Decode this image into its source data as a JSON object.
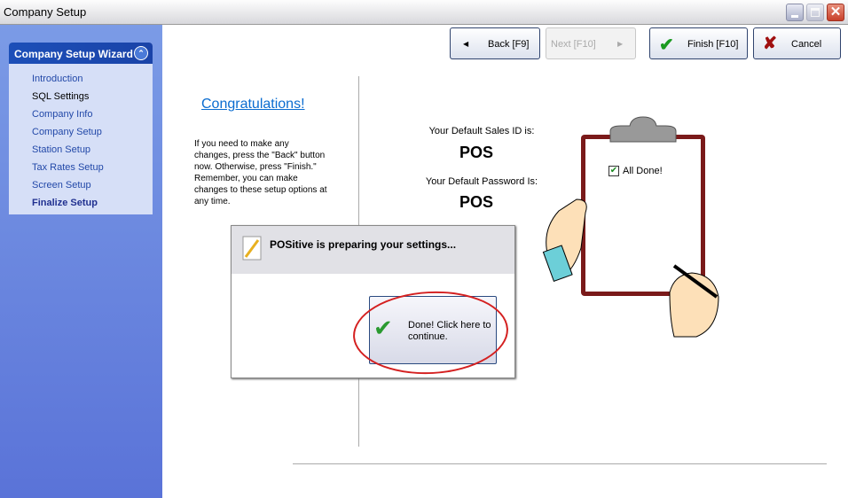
{
  "window": {
    "title": "Company Setup"
  },
  "sidebar": {
    "header": "Company Setup Wizard",
    "items": [
      {
        "label": "Introduction"
      },
      {
        "label": "SQL Settings"
      },
      {
        "label": "Company Info"
      },
      {
        "label": "Company Setup"
      },
      {
        "label": "Station Setup"
      },
      {
        "label": "Tax Rates Setup"
      },
      {
        "label": "Screen Setup"
      },
      {
        "label": "Finalize Setup"
      }
    ]
  },
  "toolbar": {
    "back": "Back [F9]",
    "next": "Next [F10]",
    "finish": "Finish [F10]",
    "cancel": "Cancel"
  },
  "main": {
    "heading": "Congratulations!",
    "instructions": "If you need to make any changes, press the \"Back\" button now.  Otherwise, press \"Finish.\"  Remember, you can make changes to these setup options at any time.",
    "sales_id_label": "Your Default Sales ID is:",
    "sales_id": "POS",
    "password_label": "Your Default Password Is:",
    "password": "POS",
    "clipboard_checkbox": "All Done!"
  },
  "dialog": {
    "title": "POSitive is preparing your settings...",
    "done_button": "Done!  Click here to continue."
  }
}
